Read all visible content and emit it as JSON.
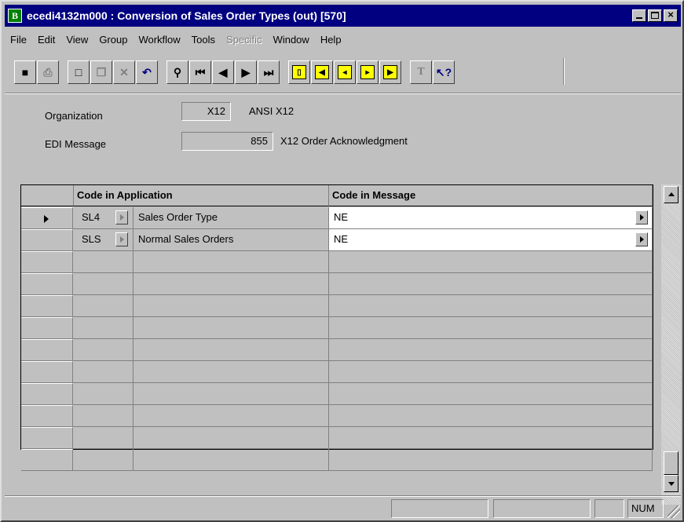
{
  "window": {
    "title": "ecedi4132m000 : Conversion of Sales Order Types (out) [570]",
    "app_icon_letter": "B"
  },
  "menu": [
    "File",
    "Edit",
    "View",
    "Group",
    "Workflow",
    "Tools",
    "Specific",
    "Window",
    "Help"
  ],
  "menu_disabled": [
    "Specific"
  ],
  "toolbar": {
    "icons": [
      "save-icon",
      "print-icon",
      "new-icon",
      "copy-icon",
      "delete-icon",
      "undo-icon",
      "find-icon",
      "first-record-icon",
      "previous-record-icon",
      "next-record-icon",
      "last-record-icon",
      "first-group-icon",
      "previous-group-icon",
      "next-group-icon",
      "last-group-icon",
      "text-icon",
      "help-pointer-icon"
    ]
  },
  "form": {
    "organization_label": "Organization",
    "organization_code": "X12",
    "organization_desc": "ANSI X12",
    "edi_message_label": "EDI Message",
    "edi_message_code": "855",
    "edi_message_desc": "X12 Order Acknowledgment"
  },
  "grid": {
    "headers": {
      "code_in_application": "Code in Application",
      "code_in_message": "Code in Message"
    },
    "rows": [
      {
        "code": "SL4",
        "description": "Sales Order Type",
        "message_code": "NE"
      },
      {
        "code": "SLS",
        "description": "Normal Sales Orders",
        "message_code": "NE"
      }
    ],
    "empty_row_count": 10
  },
  "status": {
    "num": "NUM"
  },
  "colors": {
    "titlebar": "#000080",
    "window_bg": "#c0c0c0",
    "field_white": "#ffffff",
    "group_icon_yellow": "#ffff00"
  }
}
